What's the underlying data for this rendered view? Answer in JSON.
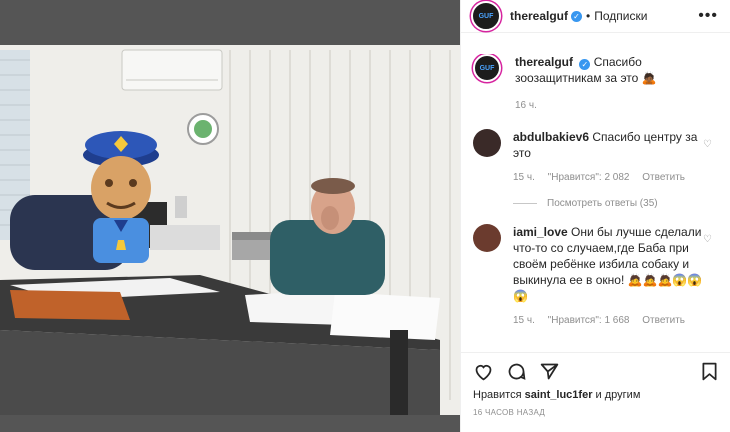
{
  "colors": {
    "accent": "#3897f0",
    "muted": "#8e8e8e",
    "border": "#efefef"
  },
  "post": {
    "author": "therealguf",
    "follow_label": "Подписки",
    "dot": "•",
    "caption": "Спасибо зоозащитникам за это 🙇🏾",
    "caption_time": "16 ч.",
    "avatar_text": "GUF"
  },
  "comments": [
    {
      "username": "abdulbakiev6",
      "text": "Спасибо центру за это",
      "time": "15 ч.",
      "likes": "\"Нравится\": 2 082",
      "reply_label": "Ответить",
      "view_replies": "Посмотреть ответы (35)"
    },
    {
      "username": "iami_love",
      "text": "Они бы лучше сделали что-то со случаем,где Баба при своём ребёнке избила собаку и выкинула ее в окно! 🙇🙇🙇😱😱😱",
      "time": "15 ч.",
      "likes": "\"Нравится\": 1 668",
      "reply_label": "Ответить"
    }
  ],
  "footer": {
    "likes_prefix": "Нравится",
    "likes_user": "saint_luc1fer",
    "likes_suffix": "и другим",
    "time_ago": "16 ЧАСОВ НАЗАД"
  }
}
